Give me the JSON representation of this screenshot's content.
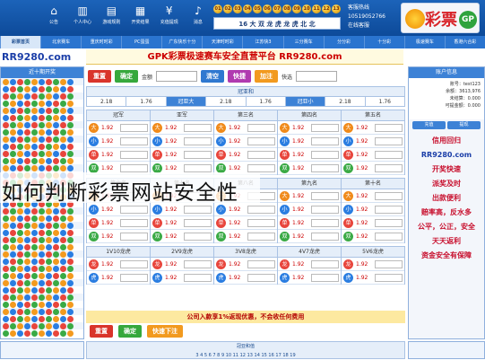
{
  "top": {
    "logo_text": "彩票",
    "contact": [
      "客服热线",
      "10519052766",
      "在线客服"
    ],
    "balls": [
      "01",
      "02",
      "03",
      "04",
      "05",
      "06",
      "07",
      "08",
      "09",
      "10",
      "11",
      "12",
      "13"
    ],
    "draw_info": "16 大 双 龙 虎 龙 虎 北 北",
    "icons": [
      {
        "name": "home-icon",
        "glyph": "⌂",
        "label": "公告"
      },
      {
        "name": "bars-icon",
        "glyph": "▥",
        "label": "个人中心"
      },
      {
        "name": "chart-icon",
        "glyph": "▤",
        "label": "游戏规则"
      },
      {
        "name": "doc-icon",
        "glyph": "▦",
        "label": "开奖结果"
      },
      {
        "name": "money-icon",
        "glyph": "¥",
        "label": "充值提现"
      },
      {
        "name": "bell-icon",
        "glyph": "♪",
        "label": "消息"
      }
    ]
  },
  "nav": {
    "tabs": [
      "彩票首页",
      "北京赛车",
      "重庆时时彩",
      "PC蛋蛋",
      "广东快乐十分",
      "天津时时彩",
      "江苏快3",
      "三分赛车",
      "分分彩",
      "十分彩",
      "极速赛车",
      "香港六合彩"
    ],
    "active_index": 0
  },
  "site": "RR9280.com",
  "banner": "GPK彩票极速赛车安全直营平台 RR9280.com",
  "left": {
    "title": "近十期开奖",
    "rows": 36
  },
  "right": {
    "title": "账户信息",
    "account": [
      "账号：test123",
      "余额：3613,976",
      "未结算：0.000",
      "可提金额：0.000"
    ],
    "btn_deposit": "充值",
    "btn_withdraw": "提现",
    "promos": [
      "信用回归",
      "RR9280.com",
      "开奖快速",
      "派奖及时",
      "出款便利",
      "赔率高，反水多",
      "公平，公正，安全",
      "天天返利",
      "资金安全有保障"
    ]
  },
  "controls": {
    "reset": "重置",
    "confirm": "确定",
    "amount_label": "金额",
    "amount_value": "",
    "quick_label": "快选",
    "quick_value": "",
    "btn_a": "清空",
    "btn_b": "快捷",
    "btn_c": "加注",
    "summary": "冠亚和",
    "odds_row": [
      "2.18",
      "1.76",
      "冠亚大",
      "2.18",
      "1.76",
      "冠亚小",
      "2.18",
      "1.76"
    ]
  },
  "columns": [
    {
      "title": "冠军",
      "rows": [
        [
          "大",
          "or",
          "1.92"
        ],
        [
          "小",
          "bl",
          "1.92"
        ],
        [
          "单",
          "rd",
          "1.92"
        ],
        [
          "双",
          "gr",
          "1.92"
        ]
      ]
    },
    {
      "title": "亚军",
      "rows": [
        [
          "大",
          "or",
          "1.92"
        ],
        [
          "小",
          "bl",
          "1.92"
        ],
        [
          "单",
          "rd",
          "1.92"
        ],
        [
          "双",
          "gr",
          "1.92"
        ]
      ]
    },
    {
      "title": "第三名",
      "rows": [
        [
          "大",
          "or",
          "1.92"
        ],
        [
          "小",
          "bl",
          "1.92"
        ],
        [
          "单",
          "rd",
          "1.92"
        ],
        [
          "双",
          "gr",
          "1.92"
        ]
      ]
    },
    {
      "title": "第四名",
      "rows": [
        [
          "大",
          "or",
          "1.92"
        ],
        [
          "小",
          "bl",
          "1.92"
        ],
        [
          "单",
          "rd",
          "1.92"
        ],
        [
          "双",
          "gr",
          "1.92"
        ]
      ]
    },
    {
      "title": "第五名",
      "rows": [
        [
          "大",
          "or",
          "1.92"
        ],
        [
          "小",
          "bl",
          "1.92"
        ],
        [
          "单",
          "rd",
          "1.92"
        ],
        [
          "双",
          "gr",
          "1.92"
        ]
      ]
    }
  ],
  "columns2": [
    {
      "title": "第六名",
      "rows": [
        [
          "大",
          "or",
          "1.92"
        ],
        [
          "小",
          "bl",
          "1.92"
        ],
        [
          "单",
          "rd",
          "1.92"
        ],
        [
          "双",
          "gr",
          "1.92"
        ]
      ]
    },
    {
      "title": "第七名",
      "rows": [
        [
          "大",
          "or",
          "1.92"
        ],
        [
          "小",
          "bl",
          "1.92"
        ],
        [
          "单",
          "rd",
          "1.92"
        ],
        [
          "双",
          "gr",
          "1.92"
        ]
      ]
    },
    {
      "title": "第八名",
      "rows": [
        [
          "大",
          "or",
          "1.92"
        ],
        [
          "小",
          "bl",
          "1.92"
        ],
        [
          "单",
          "rd",
          "1.92"
        ],
        [
          "双",
          "gr",
          "1.92"
        ]
      ]
    },
    {
      "title": "第九名",
      "rows": [
        [
          "大",
          "or",
          "1.92"
        ],
        [
          "小",
          "bl",
          "1.92"
        ],
        [
          "单",
          "rd",
          "1.92"
        ],
        [
          "双",
          "gr",
          "1.92"
        ]
      ]
    },
    {
      "title": "第十名",
      "rows": [
        [
          "大",
          "or",
          "1.92"
        ],
        [
          "小",
          "bl",
          "1.92"
        ],
        [
          "单",
          "rd",
          "1.92"
        ],
        [
          "双",
          "gr",
          "1.92"
        ]
      ]
    }
  ],
  "columns3": [
    {
      "title": "1V10龙虎",
      "rows": [
        [
          "龙",
          "rd",
          "1.92"
        ],
        [
          "虎",
          "bl",
          "1.92"
        ]
      ]
    },
    {
      "title": "2V9龙虎",
      "rows": [
        [
          "龙",
          "rd",
          "1.92"
        ],
        [
          "虎",
          "bl",
          "1.92"
        ]
      ]
    },
    {
      "title": "3V8龙虎",
      "rows": [
        [
          "龙",
          "rd",
          "1.92"
        ],
        [
          "虎",
          "bl",
          "1.92"
        ]
      ]
    },
    {
      "title": "4V7龙虎",
      "rows": [
        [
          "龙",
          "rd",
          "1.92"
        ],
        [
          "虎",
          "bl",
          "1.92"
        ]
      ]
    },
    {
      "title": "5V6龙虎",
      "rows": [
        [
          "龙",
          "rd",
          "1.92"
        ],
        [
          "虎",
          "bl",
          "1.92"
        ]
      ]
    }
  ],
  "notice": "公司入款享1%返现优惠，不会收任何费用",
  "bottom_controls": {
    "reset": "重置",
    "confirm": "确定",
    "fast": "快速下注"
  },
  "bottom_bar": [
    "冠亚和值",
    "3 4 5 6 7 8 9 10 11 12 13 14 15 16 17 18 19"
  ],
  "overlay_title": "如何判断彩票网站安全性"
}
